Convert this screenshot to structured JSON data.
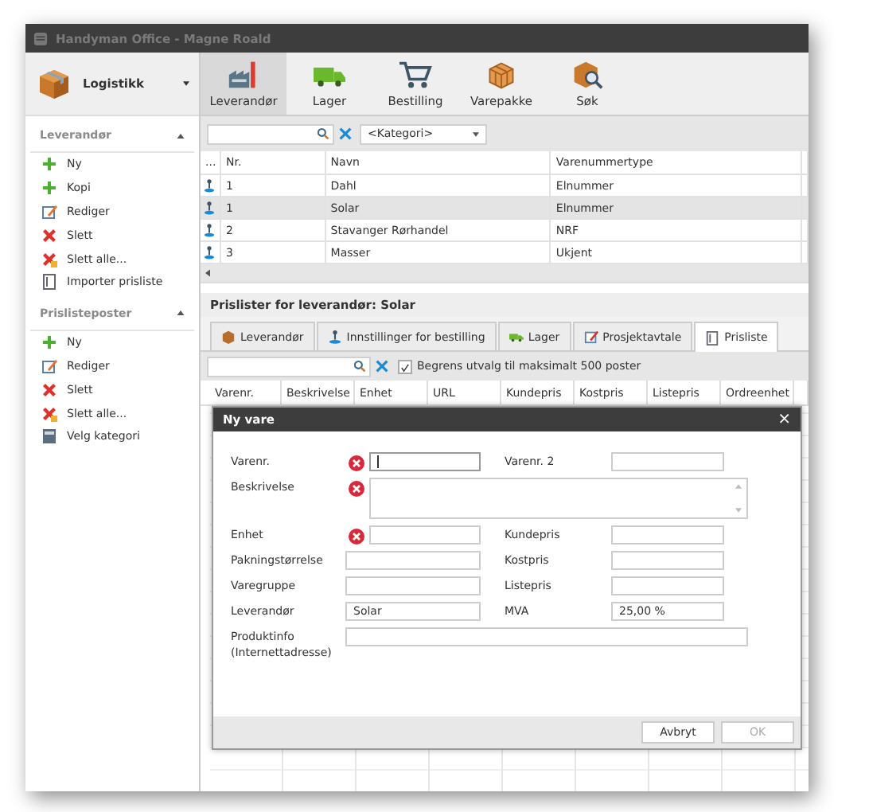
{
  "window": {
    "title": "Handyman Office - Magne Roald"
  },
  "module": {
    "label": "Logistikk"
  },
  "toolbar": [
    {
      "label": "Leverandør",
      "selected": true
    },
    {
      "label": "Lager",
      "selected": false
    },
    {
      "label": "Bestilling",
      "selected": false
    },
    {
      "label": "Varepakke",
      "selected": false
    },
    {
      "label": "Søk",
      "selected": false
    }
  ],
  "sidebar": [
    {
      "title": "Leverandør",
      "expanded": true,
      "items": [
        "Ny",
        "Kopi",
        "Rediger",
        "Slett",
        "Slett alle...",
        "Importer prisliste"
      ]
    },
    {
      "title": "Prislisteposter",
      "expanded": true,
      "items": [
        "Ny",
        "Rediger",
        "Slett",
        "Slett alle...",
        "Velg kategori"
      ]
    }
  ],
  "filter": {
    "category": "<Kategori>"
  },
  "table": {
    "columns": [
      "...",
      "Nr.",
      "Navn",
      "Varenummertype"
    ],
    "rows": [
      {
        "nr": "1",
        "navn": "Dahl",
        "type": "Elnummer",
        "selected": false
      },
      {
        "nr": "1",
        "navn": "Solar",
        "type": "Elnummer",
        "selected": true
      },
      {
        "nr": "2",
        "navn": "Stavanger Rørhandel",
        "type": "NRF",
        "selected": false
      },
      {
        "nr": "3",
        "navn": "Masser",
        "type": "Ukjent",
        "selected": false
      }
    ]
  },
  "detail": {
    "title": "Prislister for leverandør: Solar",
    "tabs": [
      {
        "label": "Leverandør",
        "selected": false
      },
      {
        "label": "Innstillinger for bestilling",
        "selected": false
      },
      {
        "label": "Lager",
        "selected": false
      },
      {
        "label": "Prosjektavtale",
        "selected": false
      },
      {
        "label": "Prisliste",
        "selected": true
      }
    ],
    "limit": {
      "label": "Begrens utvalg til maksimalt 500 poster",
      "checked": true
    },
    "columns": [
      "Varenr.",
      "Beskrivelse",
      "Enhet",
      "URL",
      "Kundepris",
      "Kostpris",
      "Listepris",
      "Ordreenhet"
    ]
  },
  "dialog": {
    "title": "Ny vare",
    "close": "×",
    "fields": [
      {
        "label": "Varenr.",
        "kind": "text",
        "error": true,
        "focused": true
      },
      {
        "label": "Varenr. 2",
        "kind": "text",
        "error": false,
        "focused": false
      },
      {
        "label": "Beskrivelse",
        "kind": "textarea",
        "error": true,
        "focused": false
      },
      {
        "label": "Enhet",
        "kind": "text",
        "error": true,
        "focused": false
      },
      {
        "label": "Kundepris",
        "kind": "text",
        "error": false,
        "focused": false
      },
      {
        "label": "Pakningstørrelse",
        "kind": "text",
        "error": false,
        "focused": false
      },
      {
        "label": "Kostpris",
        "kind": "text",
        "error": false,
        "focused": false
      },
      {
        "label": "Varegruppe",
        "kind": "text",
        "error": false,
        "focused": false
      },
      {
        "label": "Listepris",
        "kind": "text",
        "error": false,
        "focused": false
      },
      {
        "label": "Leverandør",
        "kind": "text",
        "error": false,
        "focused": false,
        "value": "Solar"
      },
      {
        "label": "MVA",
        "kind": "text",
        "error": false,
        "focused": false,
        "value": "25,00 %"
      },
      {
        "label": "Produktinfo\n(Internettadresse)",
        "kind": "wide",
        "error": false,
        "focused": false
      }
    ],
    "buttons": [
      {
        "label": "Avbryt",
        "disabled": false
      },
      {
        "label": "OK",
        "disabled": true
      }
    ]
  }
}
